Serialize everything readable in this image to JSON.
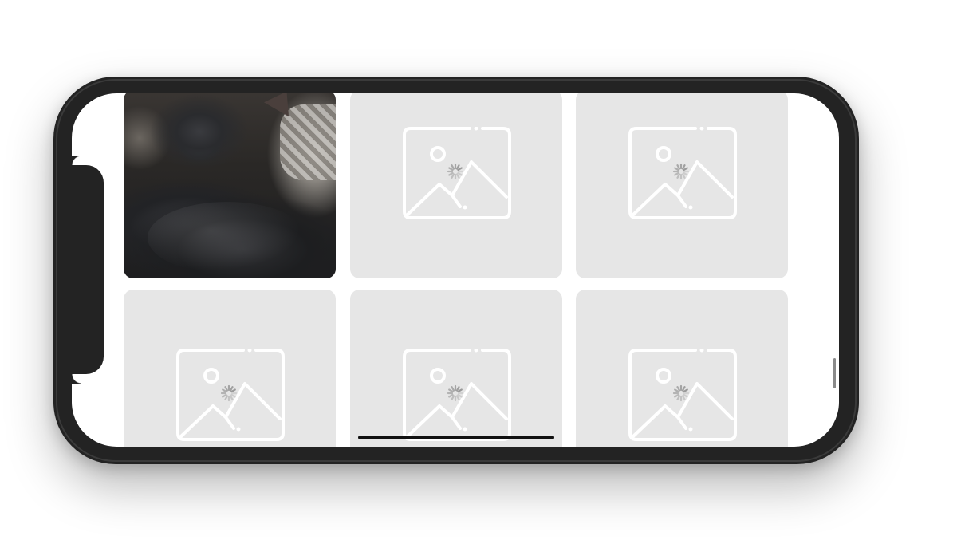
{
  "device": {
    "frame_color": "#232323",
    "screen_color": "#ffffff"
  },
  "photo_grid": {
    "placeholder_background": "#e6e6e6",
    "placeholder_icon_color": "#ffffff",
    "spinner_color": "#9a9a9a",
    "tiles": [
      {
        "state": "loaded",
        "content": "cat photo"
      },
      {
        "state": "loading",
        "icon": "image-placeholder-icon"
      },
      {
        "state": "loading",
        "icon": "image-placeholder-icon"
      },
      {
        "state": "loading",
        "icon": "image-placeholder-icon"
      },
      {
        "state": "loading",
        "icon": "image-placeholder-icon"
      },
      {
        "state": "loading",
        "icon": "image-placeholder-icon"
      }
    ]
  },
  "icons": {
    "placeholder": "image-placeholder-icon",
    "spinner": "loading-spinner-icon"
  }
}
